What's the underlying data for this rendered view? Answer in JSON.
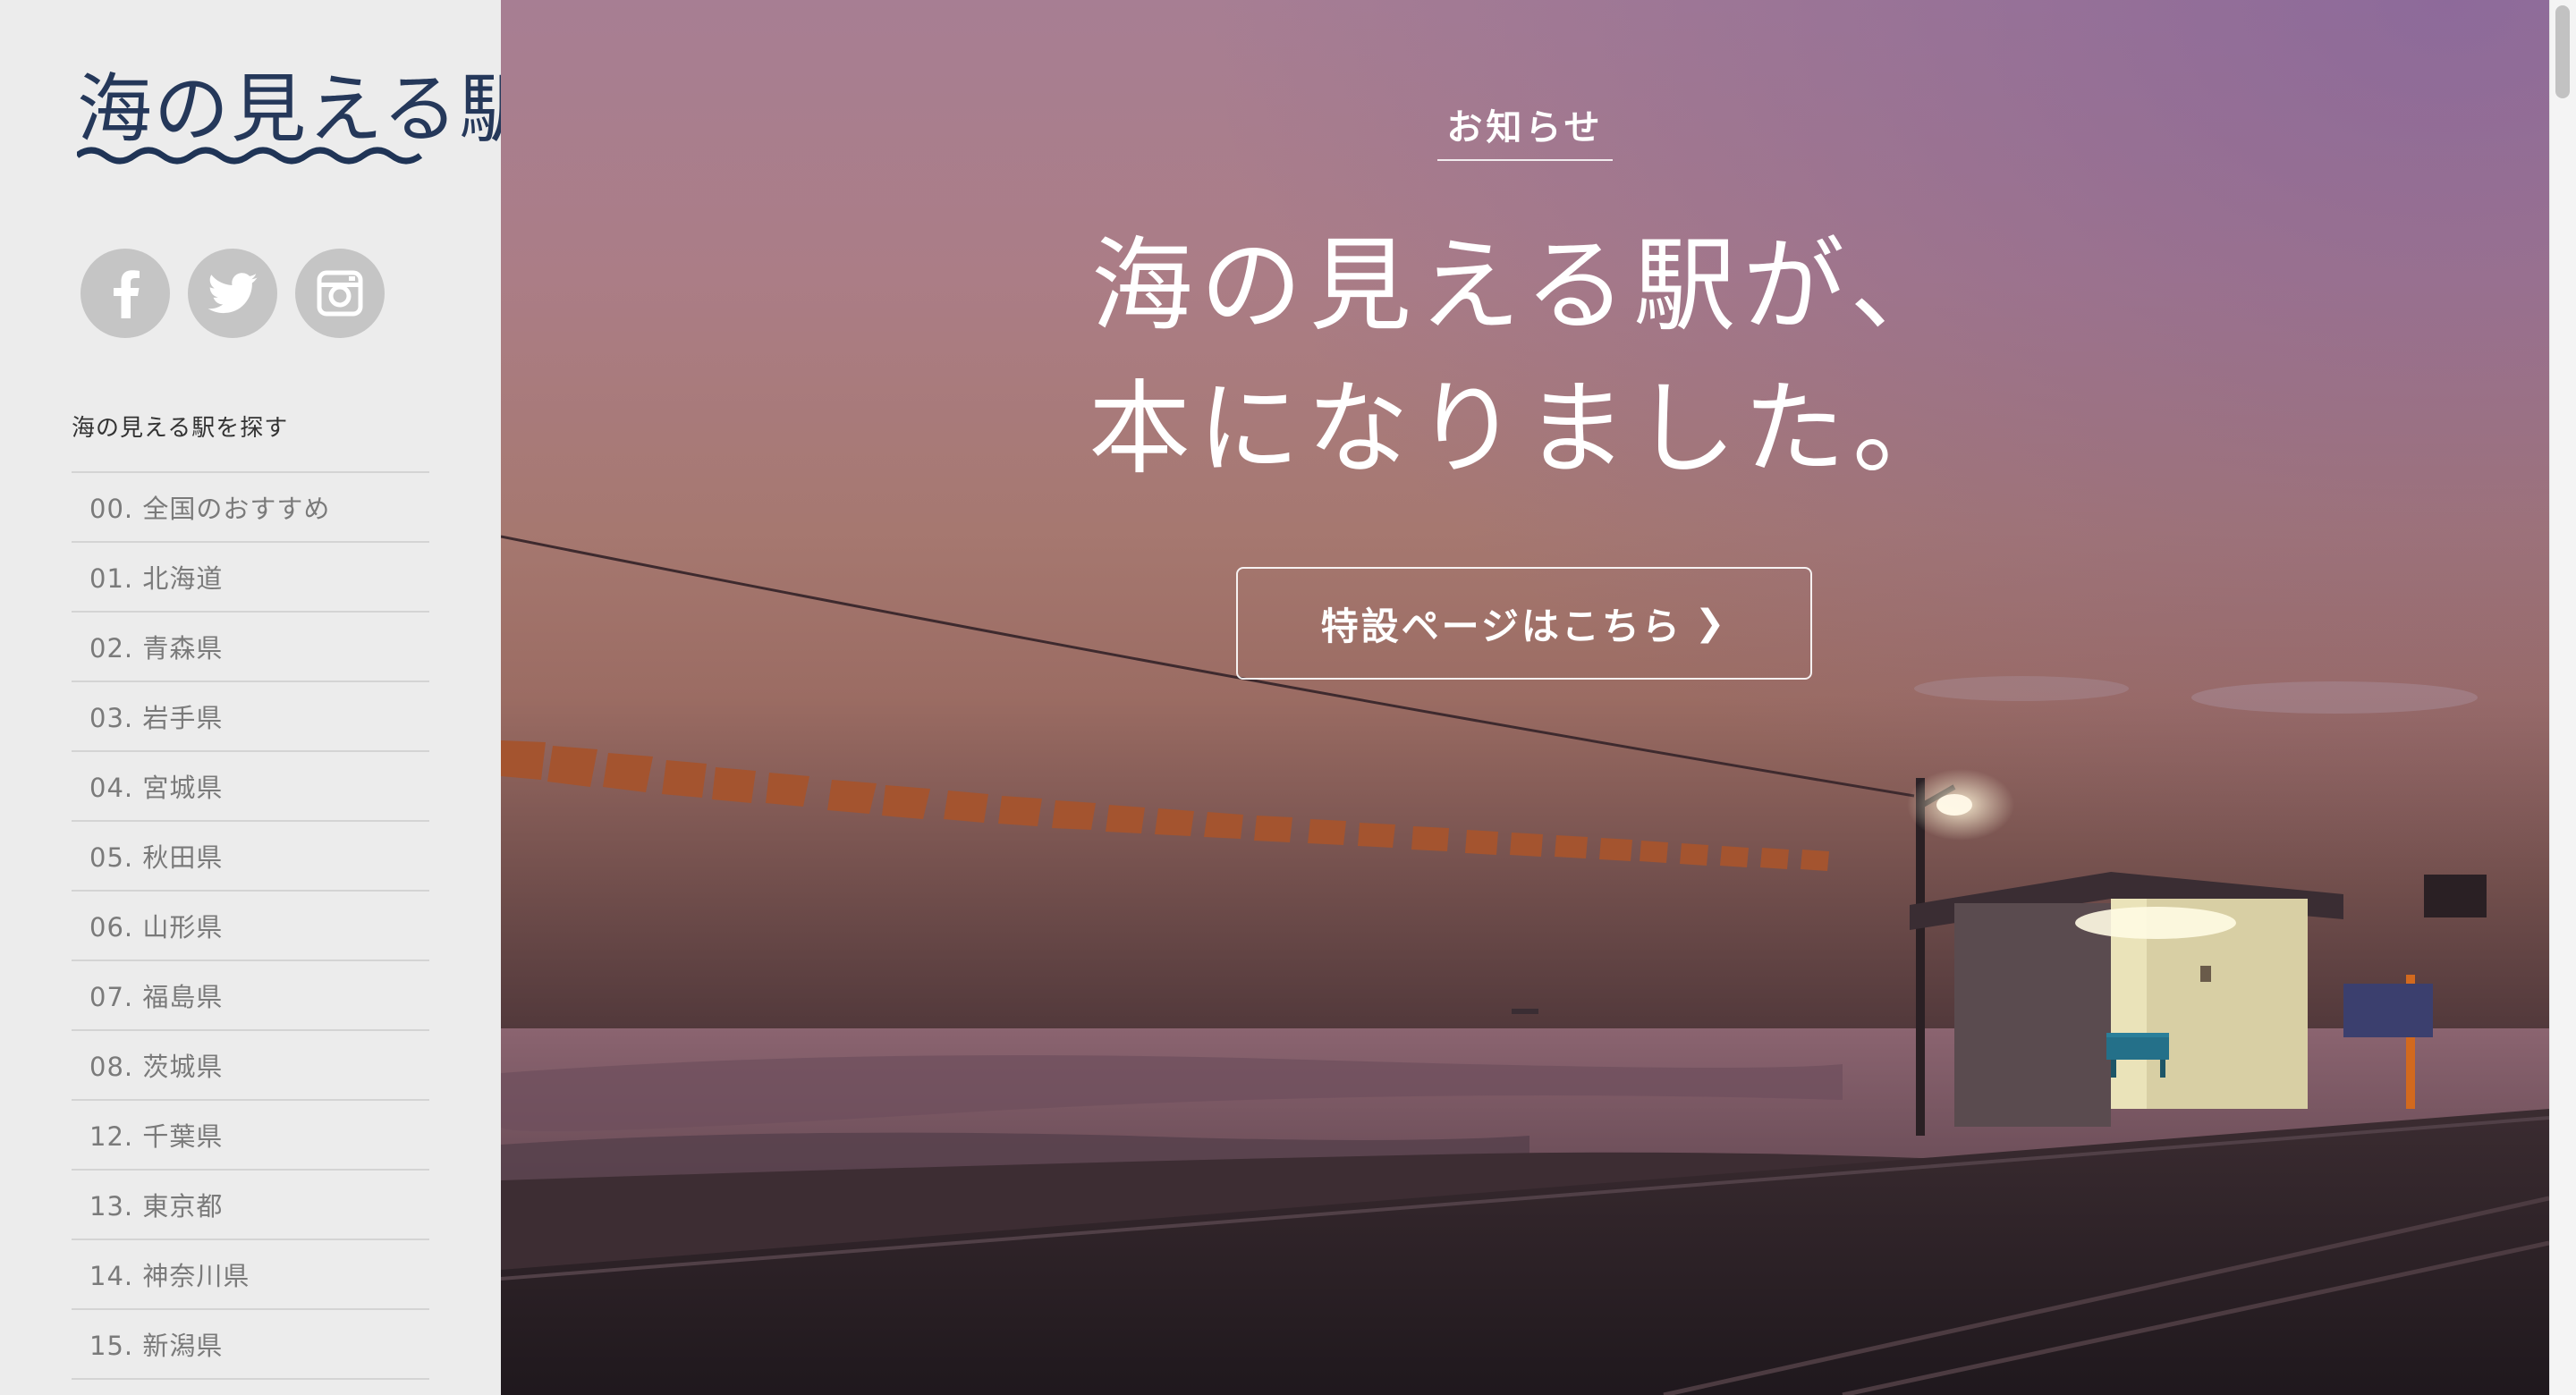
{
  "sidebar": {
    "logo_text": "海の見える駅",
    "social": [
      {
        "icon": "facebook-icon"
      },
      {
        "icon": "twitter-icon"
      },
      {
        "icon": "instagram-icon"
      }
    ],
    "nav_heading": "海の見える駅を探す",
    "nav_items": [
      "00. 全国のおすすめ",
      "01. 北海道",
      "02. 青森県",
      "03. 岩手県",
      "04. 宮城県",
      "05. 秋田県",
      "06. 山形県",
      "07. 福島県",
      "08. 茨城県",
      "12. 千葉県",
      "13. 東京都",
      "14. 神奈川県",
      "15. 新潟県"
    ]
  },
  "hero": {
    "notice_label": "お知らせ",
    "headline_line1": "海の見える駅が、",
    "headline_line2": "本になりました。",
    "cta_label": "特設ページはこちら",
    "cta_icon": "chevron-right-icon"
  },
  "colors": {
    "sidebar_bg": "#ececec",
    "logo_navy": "#1f3456",
    "social_circle": "#c5c5c5",
    "nav_text": "#7a7a7a"
  }
}
